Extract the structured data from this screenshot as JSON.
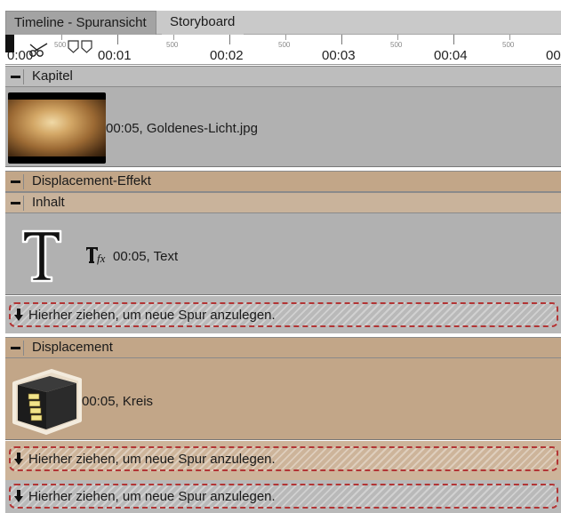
{
  "tabs": [
    {
      "label": "Timeline - Spuransicht",
      "active": true
    },
    {
      "label": "Storyboard",
      "active": false
    }
  ],
  "ruler": {
    "time_labels": [
      "0:00",
      "00:01",
      "00:02",
      "00:03",
      "00:04",
      "00"
    ],
    "sub_labels": [
      "500",
      "500",
      "500",
      "500",
      "500",
      "500"
    ]
  },
  "groups": {
    "kapitel": "Kapitel",
    "displacement_effekt": "Displacement-Effekt",
    "inhalt": "Inhalt",
    "displacement": "Displacement"
  },
  "clips": {
    "image": "00:05, Goldenes-Licht.jpg",
    "text": "00:05, Text",
    "kreis": "00:05, Kreis"
  },
  "dropzones": {
    "label": "Hierher ziehen, um neue Spur anzulegen."
  },
  "icons": [
    "scissors-icon",
    "collapse-icon",
    "text-t-icon",
    "text-fx-icon",
    "cube-icon",
    "arrow-down-icon"
  ],
  "colors": {
    "track_gray": "#b1b1b1",
    "track_tan": "#c2a688",
    "dropzone_border": "#b23535"
  }
}
